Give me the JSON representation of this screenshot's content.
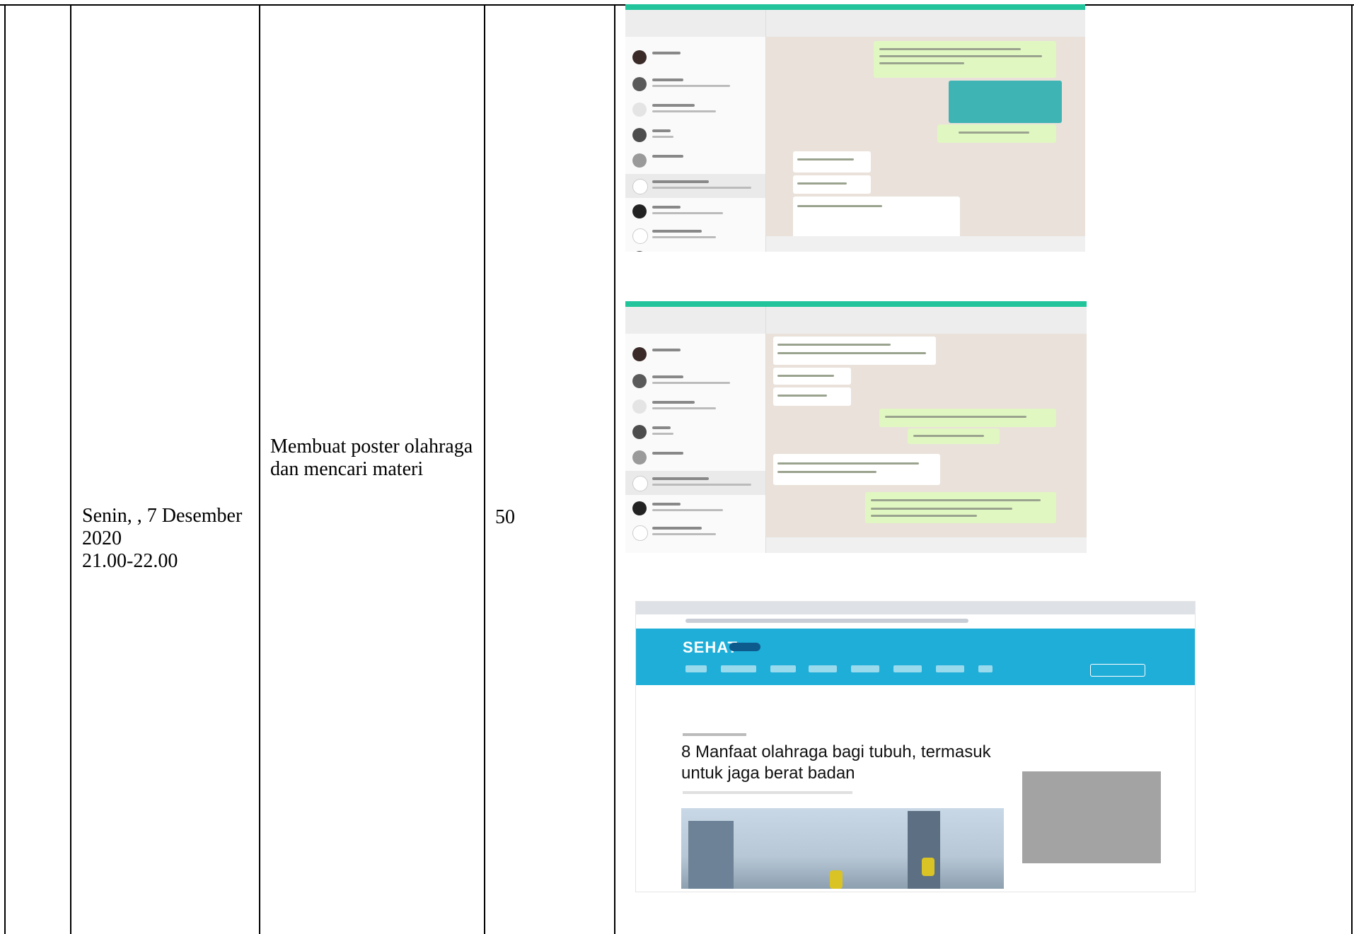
{
  "table": {
    "row": {
      "day_date": "Senin, , 7 Desember 2020",
      "time": "21.00-22.00",
      "activity": "Membuat poster olahraga dan mencari materi",
      "value": "50"
    }
  },
  "evidence": {
    "screenshots": [
      {
        "kind": "whatsapp-chat",
        "accent": "#22c49b"
      },
      {
        "kind": "whatsapp-chat",
        "accent": "#22c49b"
      },
      {
        "kind": "browser-article",
        "site_logo": "SEHAT",
        "headline": "8 Manfaat olahraga bagi tubuh, termasuk untuk jaga berat badan",
        "header_color": "#1faed8"
      }
    ]
  }
}
